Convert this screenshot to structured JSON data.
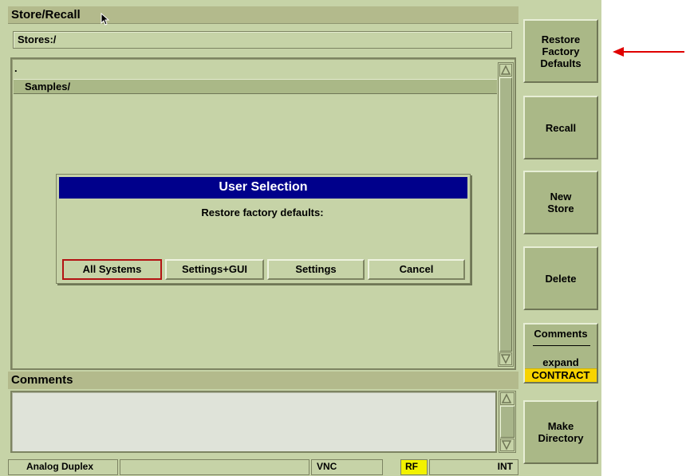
{
  "window": {
    "title": "Store/Recall"
  },
  "path": {
    "value": "Stores:/"
  },
  "file_list": {
    "current_dir_entry": ".",
    "items": [
      {
        "label": "Samples/"
      }
    ]
  },
  "dialog": {
    "title": "User Selection",
    "message": "Restore factory defaults:",
    "buttons": [
      {
        "label": "All Systems",
        "focused": true
      },
      {
        "label": "Settings+GUI"
      },
      {
        "label": "Settings"
      },
      {
        "label": "Cancel"
      }
    ]
  },
  "comments": {
    "header": "Comments",
    "value": ""
  },
  "status_bar": {
    "mode": "Analog Duplex",
    "field2": "",
    "vnc": "VNC",
    "rf": "RF",
    "int": "INT"
  },
  "softkeys": {
    "restore": "Restore\nFactory\nDefaults",
    "recall": "Recall",
    "new_store": "New\nStore",
    "delete": "Delete",
    "comments_title": "Comments",
    "expand": "expand",
    "contract": "CONTRACT",
    "make_directory": "Make\nDirectory"
  },
  "colors": {
    "background": "#c6d3a7",
    "dialog_title_bg": "#00008b",
    "focus_border": "#b31313",
    "rf_highlight": "#f2f200",
    "contract_highlight": "#f7d300",
    "annotation_arrow": "#e00000"
  }
}
